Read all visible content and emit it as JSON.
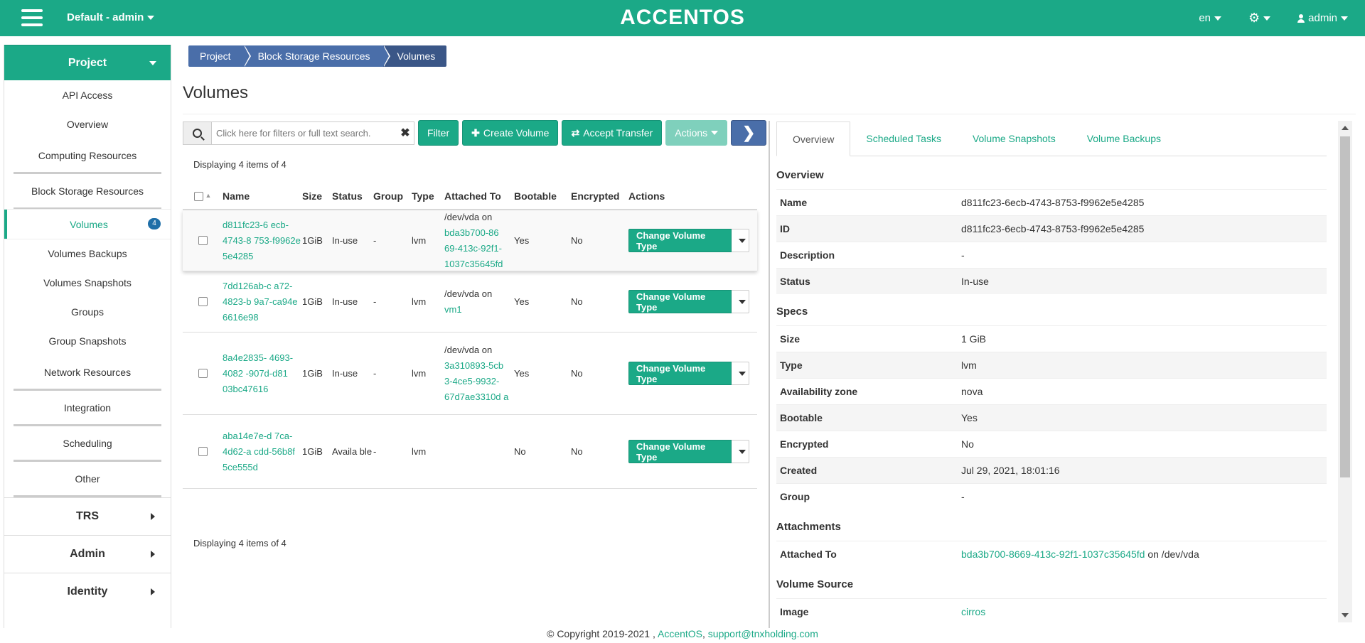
{
  "topbar": {
    "project": "Default - admin",
    "brand": "ACCENTOS",
    "language": "en",
    "user": "admin",
    "icons": [
      "menu-icon",
      "gear-icon",
      "user-icon"
    ]
  },
  "sidebar": {
    "project_label": "Project",
    "items": [
      {
        "label": "API Access",
        "kind": "link"
      },
      {
        "label": "Overview",
        "kind": "link"
      },
      {
        "label": "Computing Resources",
        "kind": "group"
      },
      {
        "label": "Block Storage Resources",
        "kind": "group"
      },
      {
        "label": "Volumes",
        "kind": "active",
        "badge": "4"
      },
      {
        "label": "Volumes Backups",
        "kind": "link"
      },
      {
        "label": "Volumes Snapshots",
        "kind": "link"
      },
      {
        "label": "Groups",
        "kind": "link"
      },
      {
        "label": "Group Snapshots",
        "kind": "link"
      },
      {
        "label": "Network Resources",
        "kind": "group"
      },
      {
        "label": "Integration",
        "kind": "group"
      },
      {
        "label": "Scheduling",
        "kind": "group"
      },
      {
        "label": "Other",
        "kind": "group"
      }
    ],
    "sections": [
      "TRS",
      "Admin",
      "Identity"
    ]
  },
  "breadcrumb": [
    "Project",
    "Block Storage Resources",
    "Volumes"
  ],
  "page_title": "Volumes",
  "toolbar": {
    "search_placeholder": "Click here for filters or full text search.",
    "filter": "Filter",
    "create": "Create Volume",
    "accept": "Accept Transfer",
    "actions": "Actions"
  },
  "count_text": "Displaying 4 items of 4",
  "table": {
    "headers": {
      "name": "Name",
      "size": "Size",
      "status": "Status",
      "group": "Group",
      "type": "Type",
      "attached": "Attached To",
      "bootable": "Bootable",
      "encrypted": "Encrypted",
      "actions": "Actions"
    },
    "rows": [
      {
        "name": "d811fc23-6 ecb-4743-8 753-f9962e 5e4285",
        "size": "1GiB",
        "status": "In-use",
        "group": "-",
        "type": "lvm",
        "attached_prefix": "/dev/vda on",
        "attached_link": "bda3b700-86 69-413c-92f1- 1037c35645fd",
        "bootable": "Yes",
        "encrypted": "No",
        "action": "Change Volume Type",
        "height": 86
      },
      {
        "name": "7dd126ab-c a72-4823-b 9a7-ca94e 6616e98",
        "size": "1GiB",
        "status": "In-use",
        "group": "-",
        "type": "lvm",
        "attached_prefix": "/dev/vda on",
        "attached_link": "vm1",
        "bootable": "Yes",
        "encrypted": "No",
        "action": "Change Volume Type",
        "height": 86
      },
      {
        "name": "8a4e2835- 4693-4082 -907d-d81 03bc47616",
        "size": "1GiB",
        "status": "In-use",
        "group": "-",
        "type": "lvm",
        "attached_prefix": "/dev/vda on",
        "attached_link": "3a310893-5cb 3-4ce5-9932- 67d7ae3310d a",
        "bootable": "Yes",
        "encrypted": "No",
        "action": "Change Volume Type",
        "height": 116
      },
      {
        "name": "aba14e7e-d 7ca-4d62-a cdd-56b8f 5ce555d",
        "size": "1GiB",
        "status": "Availa ble",
        "group": "-",
        "type": "lvm",
        "attached_prefix": "",
        "attached_link": "",
        "bootable": "No",
        "encrypted": "No",
        "action": "Change Volume Type",
        "height": 104
      }
    ]
  },
  "details": {
    "tabs": [
      "Overview",
      "Scheduled Tasks",
      "Volume Snapshots",
      "Volume Backups"
    ],
    "sections": [
      {
        "title": "Overview",
        "rows": [
          {
            "k": "Name",
            "v": "d811fc23-6ecb-4743-8753-f9962e5e4285"
          },
          {
            "k": "ID",
            "v": "d811fc23-6ecb-4743-8753-f9962e5e4285"
          },
          {
            "k": "Description",
            "v": "-"
          },
          {
            "k": "Status",
            "v": "In-use"
          }
        ]
      },
      {
        "title": "Specs",
        "rows": [
          {
            "k": "Size",
            "v": "1 GiB"
          },
          {
            "k": "Type",
            "v": "lvm"
          },
          {
            "k": "Availability zone",
            "v": "nova"
          },
          {
            "k": "Bootable",
            "v": "Yes"
          },
          {
            "k": "Encrypted",
            "v": "No"
          },
          {
            "k": "Created",
            "v": "Jul 29, 2021, 18:01:16"
          },
          {
            "k": "Group",
            "v": "-"
          }
        ]
      },
      {
        "title": "Attachments",
        "rows": [
          {
            "k": "Attached To",
            "v": "",
            "link": "bda3b700-8669-413c-92f1-1037c35645fd",
            "suffix": " on /dev/vda"
          }
        ]
      },
      {
        "title": "Volume Source",
        "rows": [
          {
            "k": "Image",
            "v": "",
            "link": "cirros"
          }
        ]
      }
    ]
  },
  "footer": {
    "copyright": "© Copyright 2019-2021 ,",
    "company": "AccentOS",
    "sep": ",",
    "email": "support@tnxholding.com"
  }
}
